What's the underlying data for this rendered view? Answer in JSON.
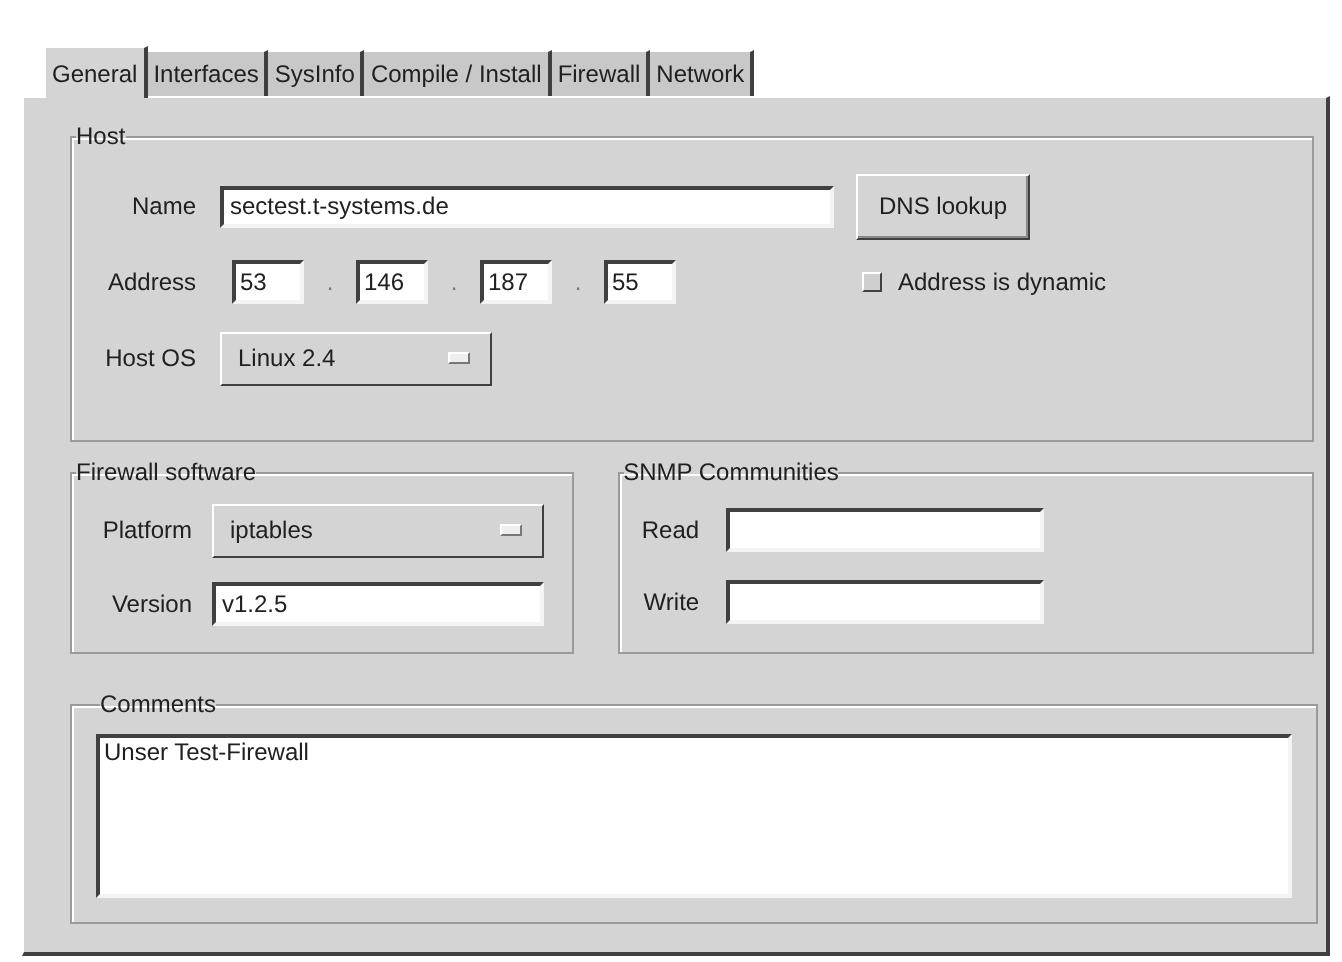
{
  "tabs": [
    {
      "label": "General",
      "selected": true
    },
    {
      "label": "Interfaces",
      "selected": false
    },
    {
      "label": "SysInfo",
      "selected": false
    },
    {
      "label": "Compile / Install",
      "selected": false
    },
    {
      "label": "Firewall",
      "selected": false
    },
    {
      "label": "Network",
      "selected": false
    }
  ],
  "host": {
    "title": "Host",
    "name_label": "Name",
    "name_value": "sectest.t-systems.de",
    "dns_button": "DNS lookup",
    "address_label": "Address",
    "octets": [
      "53",
      "146",
      "187",
      "55"
    ],
    "separators": [
      ".",
      ".",
      "."
    ],
    "dynamic": {
      "label": "Address is dynamic",
      "checked": false
    },
    "os_label": "Host OS",
    "os_value": "Linux 2.4"
  },
  "firewall_software": {
    "title": "Firewall software",
    "platform_label": "Platform",
    "platform_value": "iptables",
    "version_label": "Version",
    "version_value": "v1.2.5"
  },
  "snmp": {
    "title": "SNMP Communities",
    "read_label": "Read",
    "write_label": "Write"
  },
  "comments": {
    "title": "Comments",
    "value": "Unser Test-Firewall"
  }
}
